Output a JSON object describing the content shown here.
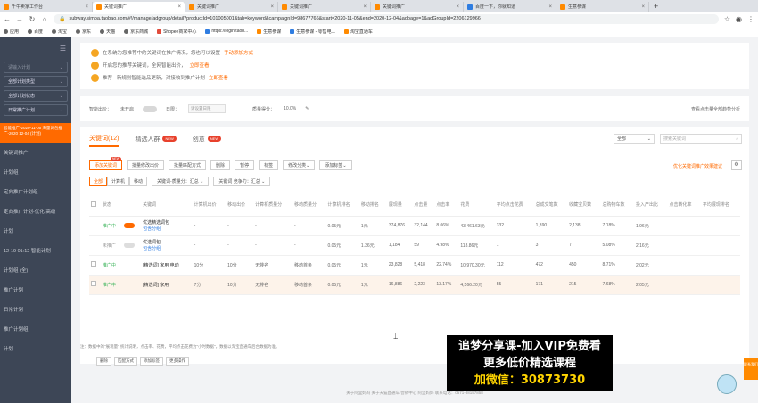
{
  "browser": {
    "tabs": [
      {
        "label": "千牛卖家工作台",
        "active": false,
        "icon": "orange"
      },
      {
        "label": "关键词推广",
        "active": true,
        "icon": "orange"
      },
      {
        "label": "关键词推广",
        "active": false,
        "icon": "orange"
      },
      {
        "label": "关键词推广",
        "active": false,
        "icon": "orange"
      },
      {
        "label": "关键词推广",
        "active": false,
        "icon": "orange"
      },
      {
        "label": "百度一下，你就知道",
        "active": false,
        "icon": "blue"
      },
      {
        "label": "生意参谋",
        "active": false,
        "icon": "orange"
      }
    ],
    "url": "subway.simba.taobao.com/#!/manage/adgroup/detail?productId=101005001&tab=keyword&campaignId=98677766&start=2020-11-05&end=2020-12-04&adpage=1&adGroupId=2206129966",
    "bookmarks": [
      "应用",
      "百度",
      "淘宝",
      "京东",
      "天猫",
      "京东商城",
      "Shopee商家中心",
      "https://login.taob...",
      "生意参谋",
      "生意参谋 - 零售电...",
      "淘宝直通车"
    ]
  },
  "sidebar": {
    "selects": [
      {
        "label": "请输入计划",
        "plain": true
      },
      {
        "label": "全部计划类型",
        "plain": false
      },
      {
        "label": "全部计划状态",
        "plain": false
      },
      {
        "label": "日常推广计划",
        "plain": false
      }
    ],
    "active_item": "智能推广-2020-11-05 海量词包推广-2020 12-04 (计划)",
    "items": [
      "关键词推广",
      "计划组",
      "定向推广计划组",
      "定向推广计划-优化 高级",
      "计划",
      "12-19 01:12 智能计划",
      "计划组 (全)",
      "推广计划",
      "日常计划",
      "推广计划组",
      "计划"
    ]
  },
  "notice": {
    "rows": [
      {
        "text": "在系统为您推荐中的关键词在推广情况，您也可以设置",
        "link": "手动添加方式"
      },
      {
        "text": "开启您的推荐关键词，全网智能出价，",
        "link": "立即查看"
      },
      {
        "text": "推荐 · 新规则智能选品更新，对接收到推广计划",
        "link": "立即查看"
      }
    ]
  },
  "settings": {
    "label1": "智能出价：",
    "label2": "未开启",
    "label3": "日限：",
    "input_placeholder": "请设置日限",
    "label4": "质量得分：",
    "value4": "10.0%",
    "right_link": "查看点击量全部趋势分析"
  },
  "subtabs": [
    {
      "label": "关键词(12)",
      "active": true,
      "new": false
    },
    {
      "label": "精选人群",
      "active": false,
      "new": true
    },
    {
      "label": "创意",
      "active": false,
      "new": true
    }
  ],
  "filter": {
    "select": "全部",
    "search_placeholder": "搜索关键词"
  },
  "buttons": [
    "添加关键词",
    "批量修改出价",
    "批量匹配方式",
    "删除",
    "暂停",
    "标签",
    "修改分类",
    "添加标签"
  ],
  "buttons_new_index": 0,
  "right_link": "优化关键词推广效果建议",
  "segmented": [
    {
      "label": "全部",
      "on": true
    },
    {
      "label": "计算机",
      "on": false
    },
    {
      "label": "移动",
      "on": false
    }
  ],
  "dropdowns": [
    "关键词-质量分：汇总",
    "关键词 竞争力：汇总"
  ],
  "table": {
    "headers": [
      "",
      "状态",
      "",
      "关键词",
      "计算机出价",
      "移动出价",
      "计算机质量分",
      "移动质量分",
      "计算机排名",
      "移动排名",
      "展现量",
      "点击量",
      "点击率",
      "花费",
      "平均点击花费",
      "总成交笔数",
      "收藏宝贝数",
      "总购物车数",
      "投入产出比",
      "点击转化率",
      "平均展现排名"
    ],
    "rows": [
      {
        "status": "推广中",
        "switch": true,
        "name": "优选精选词包",
        "sub": "包含分组",
        "pc_bid": "-",
        "m_bid": "-",
        "pc_qs": "-",
        "m_qs": "-",
        "pc_rank": "0.05元",
        "m_rank": "1元",
        "impr": "374,876",
        "clicks": "32,144",
        "ctr": "8.06%",
        "cost": "43,461.63元",
        "cpc": "332",
        "deals": "1,390",
        "fav": "2,138",
        "cart": "7.18%",
        "roi": "1.96元",
        "hl": false,
        "check": false
      },
      {
        "status": "未推广",
        "switch": false,
        "name": "优选词包",
        "sub": "包含分组",
        "pc_bid": "-",
        "m_bid": "-",
        "pc_qs": "-",
        "m_qs": "-",
        "pc_rank": "0.05元",
        "m_rank": "1.36元",
        "impr": "1,184",
        "clicks": "59",
        "ctr": "4.98%",
        "cost": "118.86元",
        "cpc": "1",
        "deals": "3",
        "fav": "7",
        "cart": "5.08%",
        "roi": "2.16元",
        "hl": false,
        "check": false
      },
      {
        "status": "推广中",
        "switch": null,
        "name": "[精选词] 家用 电动",
        "sub": "",
        "pc_bid": "10分",
        "m_bid": "10分",
        "pc_qs": "无排名",
        "m_qs": "移动首条",
        "pc_rank": "0.05元",
        "m_rank": "1元",
        "impr": "23,828",
        "clicks": "5,418",
        "ctr": "22.74%",
        "cost": "10,970.30元",
        "cpc": "112",
        "deals": "472",
        "fav": "450",
        "cart": "8.71%",
        "roi": "2.02元",
        "hl": false,
        "check": true
      },
      {
        "status": "推广中",
        "switch": null,
        "name": "[精选词] 家用",
        "sub": "",
        "pc_bid": "7分",
        "m_bid": "10分",
        "pc_qs": "无排名",
        "m_qs": "移动首条",
        "pc_rank": "0.05元",
        "m_rank": "1元",
        "impr": "16,886",
        "clicks": "2,223",
        "ctr": "13.17%",
        "cost": "4,566.20元",
        "cpc": "55",
        "deals": "171",
        "fav": "215",
        "cart": "7.68%",
        "roi": "2.05元",
        "hl": true,
        "check": true
      }
    ]
  },
  "bulk_buttons": [
    "删除",
    "匹配方式",
    "添加标签",
    "更多操作"
  ],
  "footnote": "注：数据中的\"展现量\" 统计说明，点击率、花费，平均点击花费为\"小时数据\"，数据以淘宝直通车后台数据为准。",
  "footer": "关于阿里妈妈    关于天猫直通车    营销中心    阿里妈妈  联系电话：0571-88157858",
  "promo": {
    "line1": "追梦分享课-加入VIP免费看",
    "line2": "更多低价精选课程",
    "line3": "加微信：30873730"
  },
  "side_float": "联系我们"
}
